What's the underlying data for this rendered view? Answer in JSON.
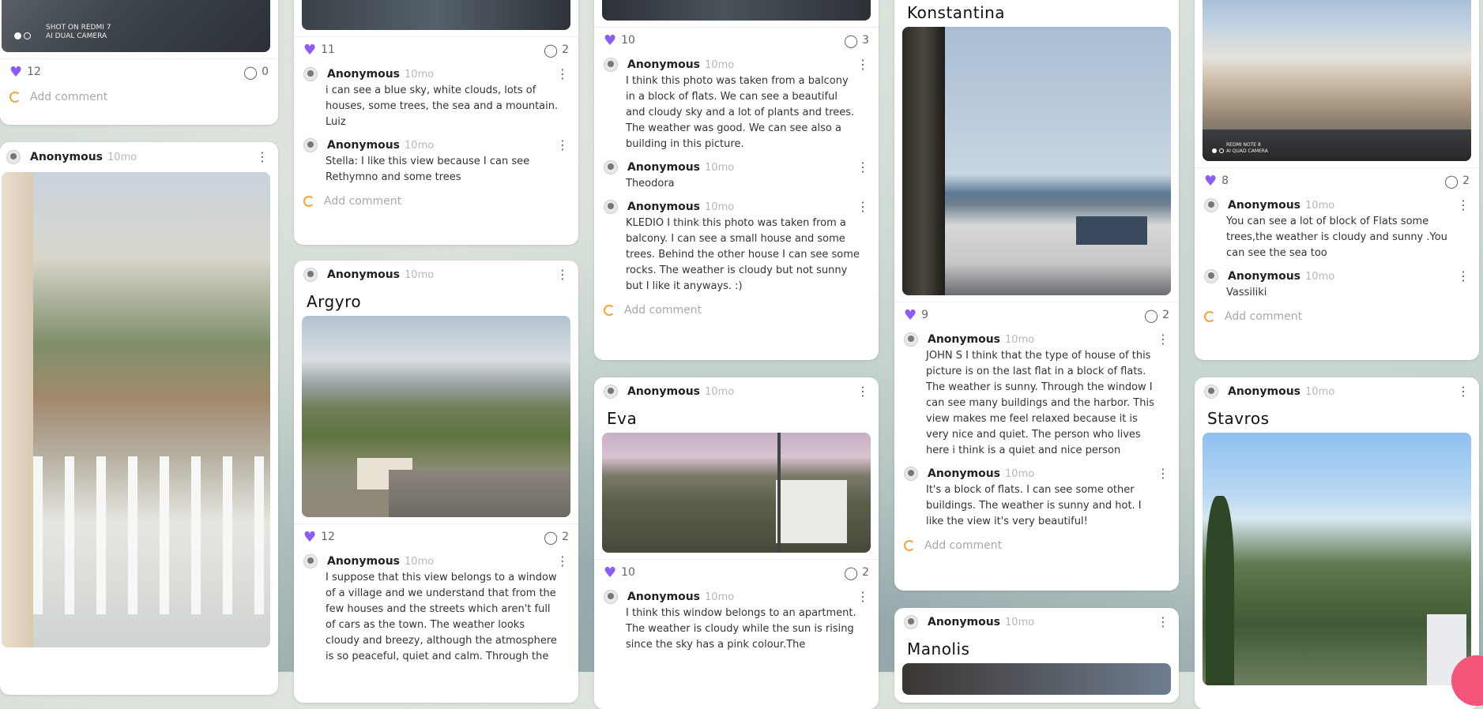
{
  "col1": {
    "top_card": {
      "camera_label_1": "SHOT ON REDMI 7",
      "camera_label_2": "AI DUAL CAMERA",
      "likes": "12",
      "comments": "0",
      "add_comment": "Add comment"
    },
    "card2": {
      "author": "Anonymous",
      "time": "10mo"
    }
  },
  "col2": {
    "top_card": {
      "likes": "11",
      "comments": "2",
      "comments_list": [
        {
          "author": "Anonymous",
          "time": "10mo",
          "text": "i can see a blue sky, white clouds, lots of houses, some trees, the sea and a mountain. Luiz"
        },
        {
          "author": "Anonymous",
          "time": "10mo",
          "text": "Stella: I like this view because I can see Rethymno and some trees"
        }
      ],
      "add_comment": "Add comment"
    },
    "card2": {
      "author": "Anonymous",
      "time": "10mo",
      "title": "Argyro",
      "likes": "12",
      "comments": "2",
      "comments_list": [
        {
          "author": "Anonymous",
          "time": "10mo",
          "text": "I suppose that this view belongs to a window of a village and we understand that from the few houses and the streets which aren't full of cars as the town. The weather looks cloudy and breezy, although the atmosphere is so peaceful, quiet and calm. Through the"
        }
      ]
    }
  },
  "col3": {
    "top_card": {
      "likes": "10",
      "comments": "3",
      "comments_list": [
        {
          "author": "Anonymous",
          "time": "10mo",
          "text": "I think this photo was taken from a balcony in a block of flats. We can see a beautiful and cloudy sky and a lot of plants and trees. The weather was good. We can see also a building in this picture."
        },
        {
          "author": "Anonymous",
          "time": "10mo",
          "text": "Theodora"
        },
        {
          "author": "Anonymous",
          "time": "10mo",
          "text": "KLEDIO I think this photo was taken from a balcony. I can see a small house and some trees. Behind the other house I can see some rocks. The weather is cloudy but not sunny but I like it anyways. :)"
        }
      ],
      "add_comment": "Add comment"
    },
    "card2": {
      "author": "Anonymous",
      "time": "10mo",
      "title": "Eva",
      "likes": "10",
      "comments": "2",
      "comments_list": [
        {
          "author": "Anonymous",
          "time": "10mo",
          "text": "I think this window belongs to an apartment. The weather is cloudy while the sun is rising since the sky has a pink colour.The"
        }
      ]
    }
  },
  "col4": {
    "top_card": {
      "title": "Konstantina",
      "likes": "9",
      "comments": "2",
      "comments_list": [
        {
          "author": "Anonymous",
          "time": "10mo",
          "text": "JOHN S I think that the type of house of this picture is on the last flat in a block of flats. The weather is sunny. Through the window I can see many buildings and the harbor. This view makes me feel relaxed because it is very nice and quiet. The person who lives here i think is a quiet and nice person"
        },
        {
          "author": "Anonymous",
          "time": "10mo",
          "text": "It's a block of flats. I can see some other buildings. The weather is sunny and hot. I like the view it's very beautiful!"
        }
      ],
      "add_comment": "Add comment"
    },
    "card2": {
      "author": "Anonymous",
      "time": "10mo",
      "title": "Manolis"
    }
  },
  "col5": {
    "top_card": {
      "camera_label_1": "REDMI NOTE 8",
      "camera_label_2": "AI QUAD CAMERA",
      "likes": "8",
      "comments": "2",
      "comments_list": [
        {
          "author": "Anonymous",
          "time": "10mo",
          "text": "You can see a lot of block of Flats some trees,the weather is cloudy and sunny .You can see the sea too"
        },
        {
          "author": "Anonymous",
          "time": "10mo",
          "text": "Vassiliki"
        }
      ],
      "add_comment": "Add comment"
    },
    "card2": {
      "author": "Anonymous",
      "time": "10mo",
      "title": "Stavros"
    }
  },
  "icons": {
    "like": "heart-icon",
    "comments": "comment-bubble-icon",
    "menu": "more-vertical-icon",
    "loading": "loading-icon"
  },
  "colors": {
    "accent": "#8b5cf6",
    "spinner": "#f4a43a",
    "fab": "#f2547a"
  }
}
